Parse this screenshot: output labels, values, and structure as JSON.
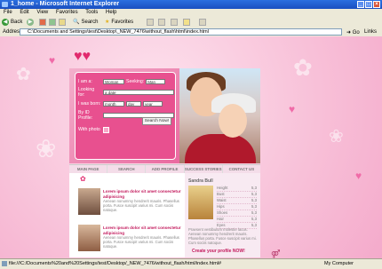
{
  "window": {
    "title": "1_home - Microsoft Internet Explorer",
    "buttons": [
      "_",
      "□",
      "×"
    ]
  },
  "menubar": [
    "File",
    "Edit",
    "View",
    "Favorites",
    "Tools",
    "Help"
  ],
  "toolbar": {
    "back_label": "Back",
    "search_label": "Search",
    "favorites_label": "Favorites"
  },
  "address": {
    "label": "Address",
    "value": "C:\\Documents and Settings\\test\\Desktop\\_NEW_7476\\without_flash\\html\\index.html",
    "go_label": "Go",
    "links_label": "Links"
  },
  "form": {
    "i_am_label": "I am a:",
    "i_am_value": "Woman",
    "seeking_label": "Seeking:",
    "seeking_value": "Man",
    "looking_for_label": "Looking for:",
    "looking_for_value": "a date",
    "born_label": "I was born:",
    "born_month": "month",
    "born_day": "day",
    "born_year": "year",
    "id_label": "By ID Profile:",
    "with_photo_label": "With photo",
    "search_button": "Search Now!"
  },
  "nav": [
    "MAIN PAGE",
    "SEARCH",
    "ADD PROFILE",
    "SUCCESS STORIES",
    "CONTACT US"
  ],
  "news": [
    {
      "title": "Lorem ipsum dolor sit amet consectetur adipisicing",
      "text": "Aenean nonummy hendrerit mauris. Phasellus porta. Fusce suscipit varius mi. Cum sociis natoque."
    },
    {
      "title": "Lorem ipsum dolor sit amet consectetur adipisicing",
      "text": "Aenean nonummy hendrerit mauris. Phasellus porta. Fusce suscipit varius mi. Cum sociis natoque."
    }
  ],
  "profile": {
    "name": "Sandra Bull",
    "stats": [
      {
        "label": "Height",
        "value": "5,3"
      },
      {
        "label": "Bust",
        "value": "5,3"
      },
      {
        "label": "Waist",
        "value": "5,3"
      },
      {
        "label": "Hips",
        "value": "5,3"
      },
      {
        "label": "Shoes",
        "value": "5,3"
      },
      {
        "label": "Hair",
        "value": "5,3"
      },
      {
        "label": "Eyes",
        "value": "5,3"
      }
    ],
    "text": "Praesent vestibulum molestie lacus. Aenean nonummy hendrerit mauris. Phasellus porta. Fusce suscipit varius mi. Cum sociis natoque.",
    "link": "Create your profile NOW!"
  },
  "statusbar": {
    "text": "file:///C:/Documents%20and%20Settings/test/Desktop/_NEW_7476/without_flash/html/index.html#",
    "zone": "My Computer"
  }
}
